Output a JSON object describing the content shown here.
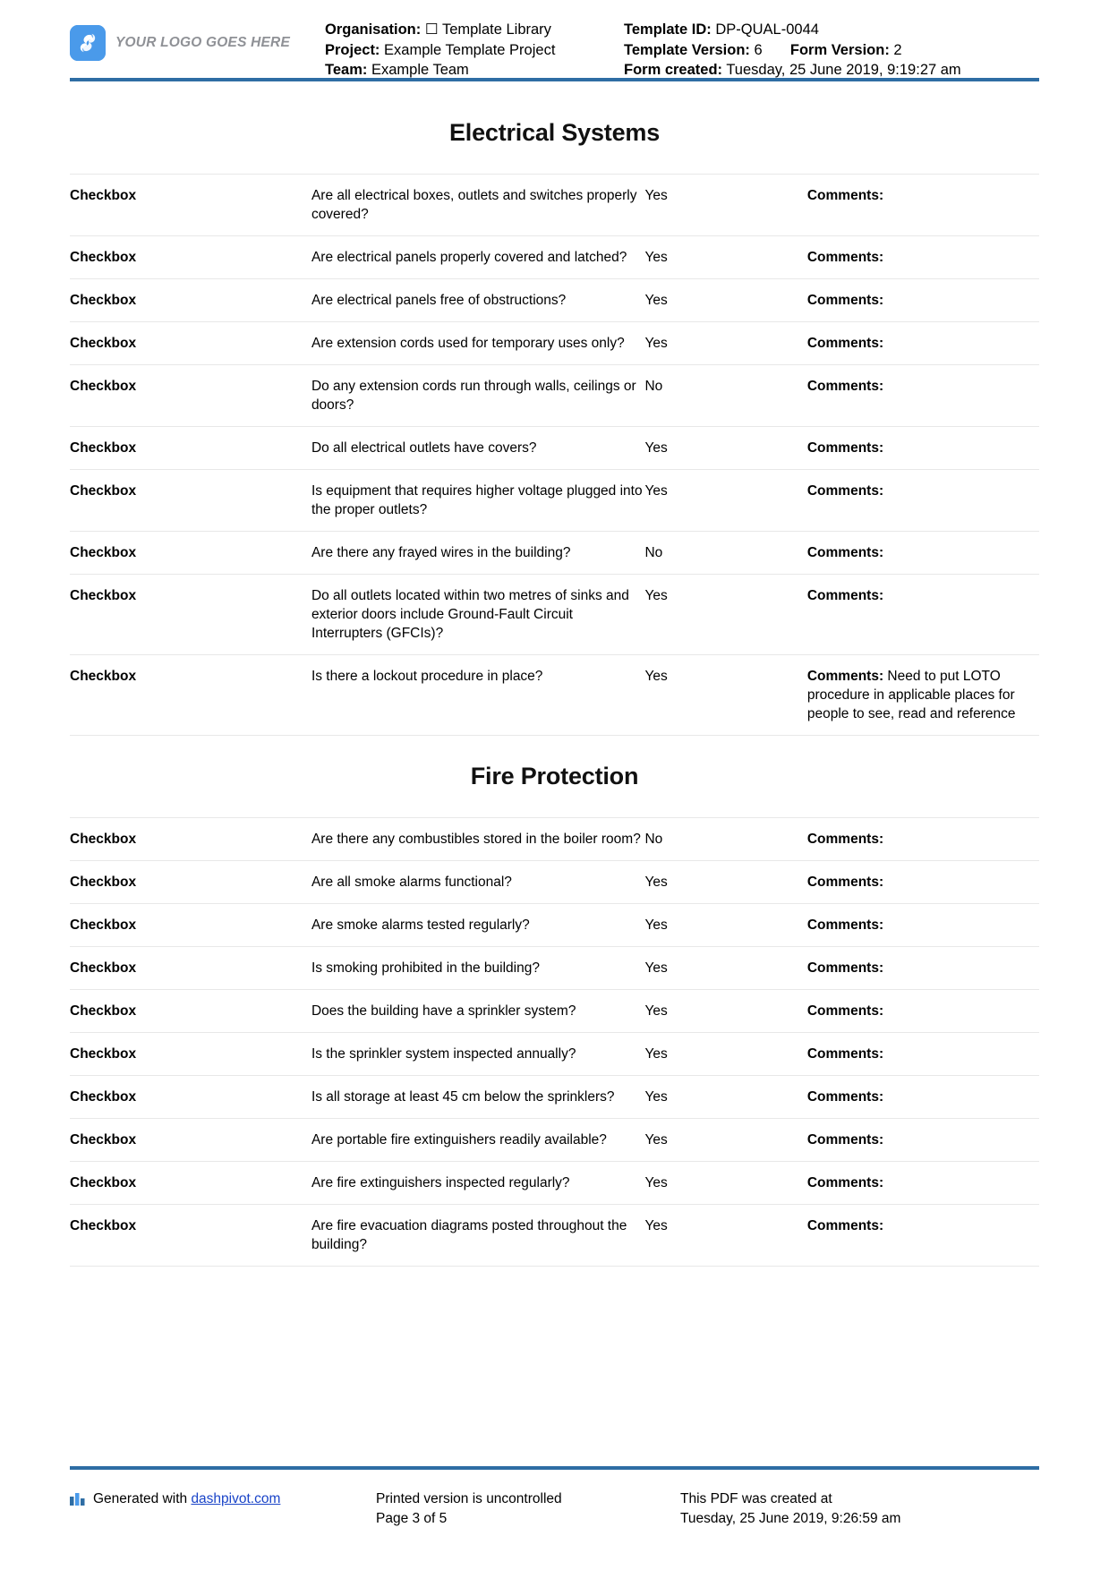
{
  "header": {
    "logo": {
      "icon": "logo-mark-icon",
      "text": "YOUR LOGO GOES HERE"
    },
    "left": {
      "organisation_label": "Organisation:",
      "organisation_value": "☐ Template Library",
      "project_label": "Project:",
      "project_value": "Example Template Project",
      "team_label": "Team:",
      "team_value": "Example Team"
    },
    "right": {
      "template_id_label": "Template ID:",
      "template_id_value": "DP-QUAL-0044",
      "template_version_label": "Template Version:",
      "template_version_value": "6",
      "form_version_label": "Form Version:",
      "form_version_value": "2",
      "form_created_label": "Form created:",
      "form_created_value": "Tuesday, 25 June 2019, 9:19:27 am"
    }
  },
  "sections": [
    {
      "title": "Electrical Systems",
      "rows": [
        {
          "type": "Checkbox",
          "question": "Are all electrical boxes, outlets and switches properly covered?",
          "answer": "Yes",
          "comment_label": "Comments:",
          "comment_value": ""
        },
        {
          "type": "Checkbox",
          "question": "Are electrical panels properly covered and latched?",
          "answer": "Yes",
          "comment_label": "Comments:",
          "comment_value": ""
        },
        {
          "type": "Checkbox",
          "question": "Are electrical panels free of obstructions?",
          "answer": "Yes",
          "comment_label": "Comments:",
          "comment_value": ""
        },
        {
          "type": "Checkbox",
          "question": "Are extension cords used for temporary uses only?",
          "answer": "Yes",
          "comment_label": "Comments:",
          "comment_value": ""
        },
        {
          "type": "Checkbox",
          "question": "Do any extension cords run through walls, ceilings or doors?",
          "answer": "No",
          "comment_label": "Comments:",
          "comment_value": ""
        },
        {
          "type": "Checkbox",
          "question": "Do all electrical outlets have covers?",
          "answer": "Yes",
          "comment_label": "Comments:",
          "comment_value": ""
        },
        {
          "type": "Checkbox",
          "question": "Is equipment that requires higher voltage plugged into the proper outlets?",
          "answer": "Yes",
          "comment_label": "Comments:",
          "comment_value": ""
        },
        {
          "type": "Checkbox",
          "question": "Are there any frayed wires in the building?",
          "answer": "No",
          "comment_label": "Comments:",
          "comment_value": ""
        },
        {
          "type": "Checkbox",
          "question": "Do all outlets located within two metres of sinks and exterior doors include Ground-Fault Circuit Interrupters (GFCIs)?",
          "answer": "Yes",
          "comment_label": "Comments:",
          "comment_value": ""
        },
        {
          "type": "Checkbox",
          "question": "Is there a lockout procedure in place?",
          "answer": "Yes",
          "comment_label": "Comments:",
          "comment_value": " Need to put LOTO procedure in applicable places for people to see, read and reference"
        }
      ]
    },
    {
      "title": "Fire Protection",
      "rows": [
        {
          "type": "Checkbox",
          "question": "Are there any combustibles stored in the boiler room?",
          "answer": "No",
          "comment_label": "Comments:",
          "comment_value": ""
        },
        {
          "type": "Checkbox",
          "question": "Are all smoke alarms functional?",
          "answer": "Yes",
          "comment_label": "Comments:",
          "comment_value": ""
        },
        {
          "type": "Checkbox",
          "question": "Are smoke alarms tested regularly?",
          "answer": "Yes",
          "comment_label": "Comments:",
          "comment_value": ""
        },
        {
          "type": "Checkbox",
          "question": "Is smoking prohibited in the building?",
          "answer": "Yes",
          "comment_label": "Comments:",
          "comment_value": ""
        },
        {
          "type": "Checkbox",
          "question": "Does the building have a sprinkler system?",
          "answer": "Yes",
          "comment_label": "Comments:",
          "comment_value": ""
        },
        {
          "type": "Checkbox",
          "question": "Is the sprinkler system inspected annually?",
          "answer": "Yes",
          "comment_label": "Comments:",
          "comment_value": ""
        },
        {
          "type": "Checkbox",
          "question": "Is all storage at least 45 cm below the sprinklers?",
          "answer": "Yes",
          "comment_label": "Comments:",
          "comment_value": ""
        },
        {
          "type": "Checkbox",
          "question": "Are portable fire extinguishers readily available?",
          "answer": "Yes",
          "comment_label": "Comments:",
          "comment_value": ""
        },
        {
          "type": "Checkbox",
          "question": "Are fire extinguishers inspected regularly?",
          "answer": "Yes",
          "comment_label": "Comments:",
          "comment_value": ""
        },
        {
          "type": "Checkbox",
          "question": "Are fire evacuation diagrams posted throughout the building?",
          "answer": "Yes",
          "comment_label": "Comments:",
          "comment_value": ""
        }
      ]
    }
  ],
  "footer": {
    "generated_prefix": "Generated with ",
    "generated_link": "dashpivot.com",
    "printed_notice": "Printed version is uncontrolled",
    "page_number": "Page 3 of 5",
    "pdf_created_line1": "This PDF was created at",
    "pdf_created_line2": "Tuesday, 25 June 2019, 9:26:59 am",
    "chart_icon": "bar-chart-icon"
  },
  "colors": {
    "accent_blue": "#2e6da4",
    "logo_blue": "#4a9aea",
    "link_blue": "#1a44c8",
    "muted_grey": "#8f9196"
  }
}
